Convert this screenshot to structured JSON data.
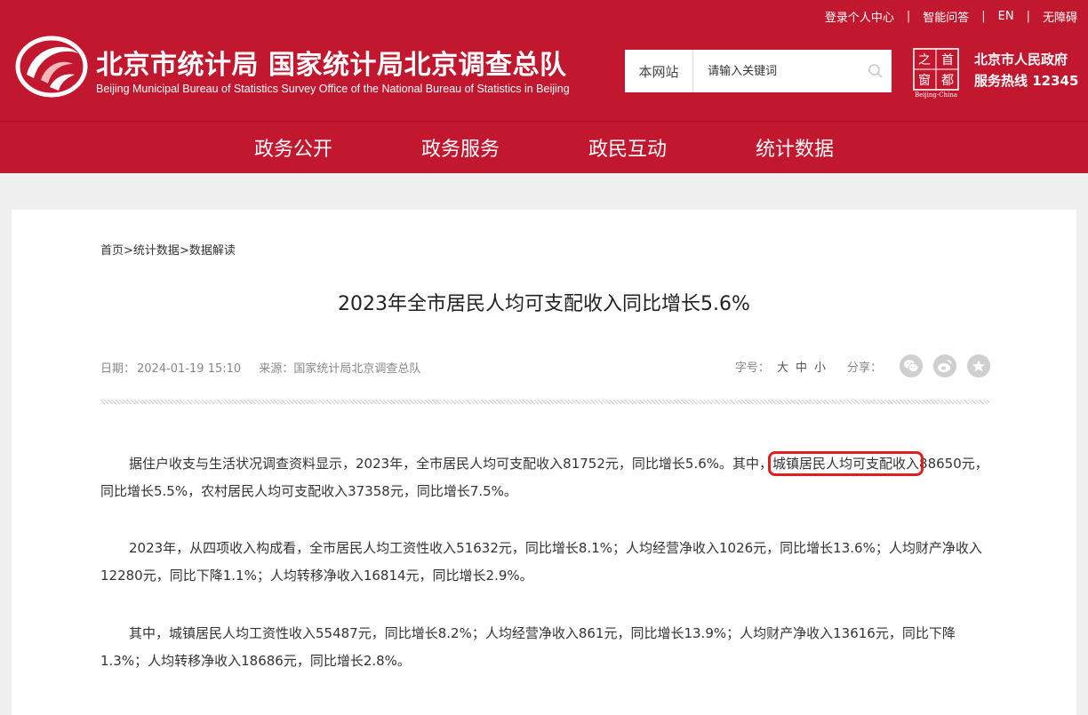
{
  "top_links": {
    "login": "登录个人中心",
    "smart_qa": "智能问答",
    "en": "EN",
    "accessibility": "无障碍",
    "separator": "|"
  },
  "logo": {
    "cn_title": "北京市统计局 国家统计局北京调查总队",
    "en_title": "Beijing Municipal Bureau of Statistics  Survey Office of the National Bureau of Statistics in Beijing"
  },
  "search": {
    "scope": "本网站",
    "placeholder": "请输入关键词",
    "icon": "search-icon"
  },
  "capital_badge": {
    "chars": [
      "之",
      "首",
      "窗",
      "都"
    ],
    "caption": "Beijing-China"
  },
  "hotline": {
    "line1": "北京市人民政府",
    "line2": "服务热线 12345"
  },
  "main_nav": {
    "items": [
      {
        "label": "政务公开"
      },
      {
        "label": "政务服务"
      },
      {
        "label": "政民互动"
      },
      {
        "label": "统计数据"
      }
    ]
  },
  "breadcrumb": {
    "home": "首页",
    "level2": "统计数据",
    "level3": "数据解读",
    "sep": ">"
  },
  "article": {
    "title": "2023年全市居民人均可支配收入同比增长5.6%",
    "date_label": "日期：",
    "date": "2024-01-19 15:10",
    "source_label": "来源：",
    "source": "国家统计局北京调查总队",
    "font_size_label": "字号：",
    "font_sizes": [
      "大",
      "中",
      "小"
    ],
    "share_label": "分享：",
    "share_icons": [
      "wechat-icon",
      "weibo-icon",
      "favorite-star-icon"
    ],
    "p1_before": "据住户收支与生活状况调查资料显示，2023年，全市居民人均可支配收入81752元，同比增长5.6%。其中，",
    "p1_highlight": "城镇居民人均可支配收入",
    "p1_after": "88650元，同比增长5.5%，农村居民人均可支配收入37358元，同比增长7.5%。",
    "p2": "2023年，从四项收入构成看，全市居民人均工资性收入51632元，同比增长8.1%；人均经营净收入1026元，同比增长13.6%；人均财产净收入12280元，同比下降1.1%；人均转移净收入16814元，同比增长2.9%。",
    "p3": "其中，城镇居民人均工资性收入55487元，同比增长8.2%；人均经营净收入861元，同比增长13.9%；人均财产净收入13616元，同比下降1.3%；人均转移净收入18686元，同比增长2.8%。"
  },
  "colors": {
    "brand_red": "#c1182f",
    "highlight_red": "#e02020",
    "page_bg": "#f0f0f0"
  }
}
